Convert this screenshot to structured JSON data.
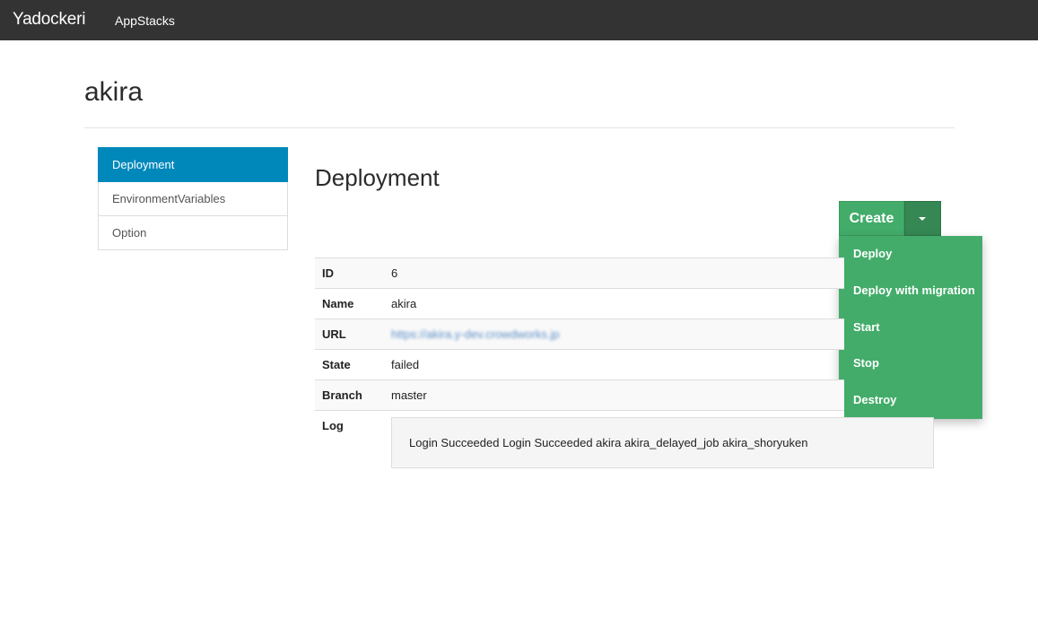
{
  "navbar": {
    "brand": "Yadockeri",
    "links": [
      "AppStacks"
    ]
  },
  "page": {
    "title": "akira"
  },
  "sidebar": {
    "items": [
      {
        "label": "Deployment",
        "active": true
      },
      {
        "label": "EnvironmentVariables",
        "active": false
      },
      {
        "label": "Option",
        "active": false
      }
    ]
  },
  "main": {
    "section_title": "Deployment",
    "create_button": {
      "label": "Create",
      "color": "#43ac6a"
    },
    "dropdown_items": [
      "Deploy",
      "Deploy with migration",
      "Start",
      "Stop",
      "Destroy"
    ],
    "details": {
      "rows": [
        {
          "key": "ID",
          "value": "6"
        },
        {
          "key": "Name",
          "value": "akira"
        },
        {
          "key": "URL",
          "value": "https://akira.y-dev.crowdworks.jp"
        },
        {
          "key": "State",
          "value": "failed"
        },
        {
          "key": "Branch",
          "value": "master"
        }
      ],
      "log_label": "Log",
      "log_text": "Login Succeeded Login Succeeded akira akira_delayed_job akira_shoryuken"
    }
  },
  "colors": {
    "navbar": "#333333",
    "active_nav": "#0088bb",
    "success": "#43ac6a"
  }
}
